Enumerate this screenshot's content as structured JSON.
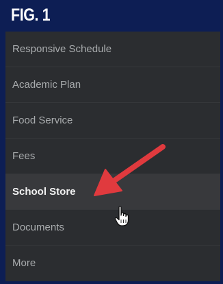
{
  "figure": {
    "title": "FIG. 1"
  },
  "menu": {
    "items": [
      {
        "label": "Responsive Schedule",
        "active": false
      },
      {
        "label": "Academic Plan",
        "active": false
      },
      {
        "label": "Food Service",
        "active": false
      },
      {
        "label": "Fees",
        "active": false
      },
      {
        "label": "School Store",
        "active": true
      },
      {
        "label": "Documents",
        "active": false
      },
      {
        "label": "More",
        "active": false
      }
    ]
  },
  "annotation": {
    "arrow_icon": "red-arrow-icon",
    "arrow_color": "#e03a3e",
    "cursor_icon": "hand-pointer-icon"
  },
  "colors": {
    "frame": "#0d1e54",
    "menu_background": "#2b2d30",
    "active_background": "#38393c",
    "item_text": "#a9acae",
    "active_text": "#f2f2f2"
  }
}
